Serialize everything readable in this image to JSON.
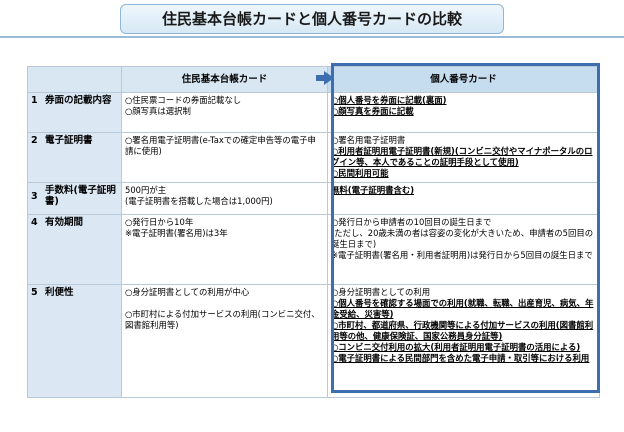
{
  "title": "住民基本台帳カードと個人番号カードの比較",
  "columns": {
    "juki_card": "住民基本台帳カード",
    "my_number_card": "個人番号カード"
  },
  "rows": [
    {
      "num": "1",
      "label": "券面の記載内容",
      "juki": [
        "○住民票コードの券面記載なし",
        "○顔写真は選択制"
      ],
      "mynumber": [
        "○個人番号を券面に記載(裏面)",
        "○顔写真を券面に記載"
      ]
    },
    {
      "num": "2",
      "label": "電子証明書",
      "juki": [
        "○署名用電子証明書(e-Taxでの確定申告等の電子申請に使用)"
      ],
      "mynumber": [
        "○署名用電子証明書",
        "○利用者証明用電子証明書(新規)(コンビニ交付やマイナポータルのログイン等、本人であることの証明手段として使用)",
        "○民間利用可能"
      ]
    },
    {
      "num": "3",
      "label": "手数料(電子証明書)",
      "juki": [
        "500円が主",
        "(電子証明書を搭載した場合は1,000円)"
      ],
      "mynumber": [
        "無料(電子証明書含む)"
      ]
    },
    {
      "num": "4",
      "label": "有効期間",
      "juki": [
        "○発行日から10年",
        "※電子証明書(署名用)は3年"
      ],
      "mynumber": [
        "○発行日から申請者の10回目の誕生日まで",
        "(ただし、20歳未満の者は容姿の変化が大きいため、申請者の5回目の誕生日まで)",
        "※電子証明書(署名用・利用者証明用)は発行日から5回目の誕生日まで"
      ]
    },
    {
      "num": "5",
      "label": "利便性",
      "juki": [
        "○身分証明書としての利用が中心",
        "○市町村による付加サービスの利用(コンビニ交付、図書館利用等)"
      ],
      "mynumber": [
        "○身分証明書としての利用",
        "○個人番号を確認する場面での利用(就職、転職、出産育児、病気、年金受給、災害等)",
        "○市町村、都道府県、行政機関等による付加サービスの利用(図書館利用等の他、健康保険証、国家公務員身分証等)",
        "○コンビニ交付利用の拡大(利用者証明用電子証明書の活用による)",
        "○電子証明書による民間部門を含めた電子申請・取引等における利用"
      ]
    }
  ]
}
